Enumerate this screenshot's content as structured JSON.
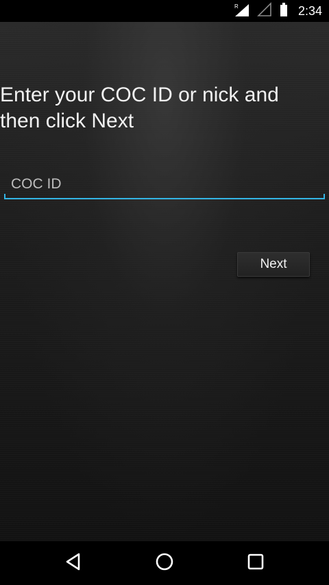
{
  "status_bar": {
    "time": "2:34",
    "icons": [
      "roaming-signal-icon",
      "cell-signal-icon",
      "battery-icon"
    ]
  },
  "main": {
    "prompt": "Enter your COC ID or nick and then click Next",
    "input": {
      "placeholder": "COC ID",
      "value": ""
    },
    "next_label": "Next"
  },
  "nav_bar": {
    "icons": [
      "back-icon",
      "home-icon",
      "recents-icon"
    ]
  },
  "colors": {
    "accent": "#33b5e5",
    "text": "#f2f2f2",
    "background": "#1d1d1d"
  }
}
